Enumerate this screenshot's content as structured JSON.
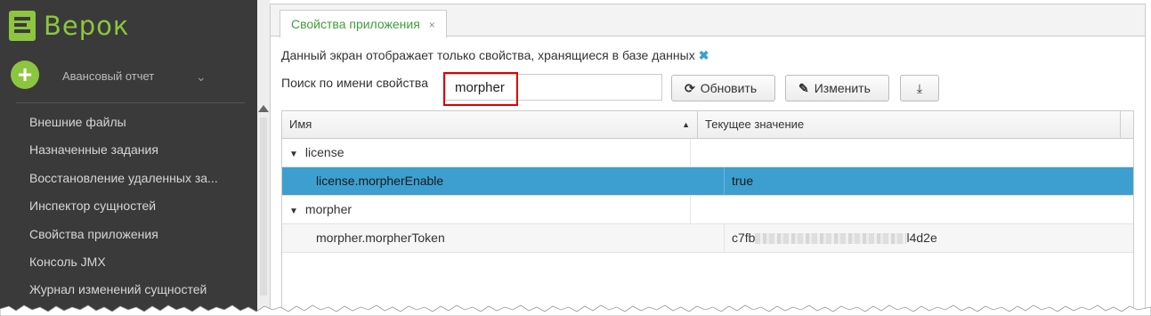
{
  "sidebar": {
    "logo_text": "Верок",
    "report_label": "Авансовый отчет",
    "items": [
      {
        "label": "Внешние файлы"
      },
      {
        "label": "Назначенные задания"
      },
      {
        "label": "Восстановление удаленных за..."
      },
      {
        "label": "Инспектор сущностей"
      },
      {
        "label": "Свойства приложения"
      },
      {
        "label": "Консоль JMX"
      },
      {
        "label": "Журнал изменений сущностей"
      }
    ]
  },
  "tab": {
    "label": "Свойства приложения",
    "close_glyph": "×"
  },
  "info": {
    "text": "Данный экран отображает только свойства, хранящиеся в базе данных",
    "close_glyph": "✖"
  },
  "search": {
    "label": "Поиск по имени свойства",
    "value": "morpher"
  },
  "buttons": {
    "refresh_icon": "⟳",
    "refresh": "Обновить",
    "edit_icon": "✎",
    "edit": "Изменить",
    "export_icon": "⤓"
  },
  "table": {
    "headers": {
      "name": "Имя",
      "value": "Текущее значение"
    },
    "rows": [
      {
        "name": "license",
        "value": ""
      },
      {
        "name": "license.morpherEnable",
        "value": "true"
      },
      {
        "name": "morpher",
        "value": ""
      },
      {
        "name": "morpher.morpherToken",
        "value_prefix": "c7fb",
        "value_suffix": "l4d2e"
      }
    ]
  },
  "colors": {
    "accent": "#8cc63f",
    "sidebar_bg": "#3a3a3a",
    "selection": "#3d9fcf",
    "highlight": "#dd0000"
  }
}
